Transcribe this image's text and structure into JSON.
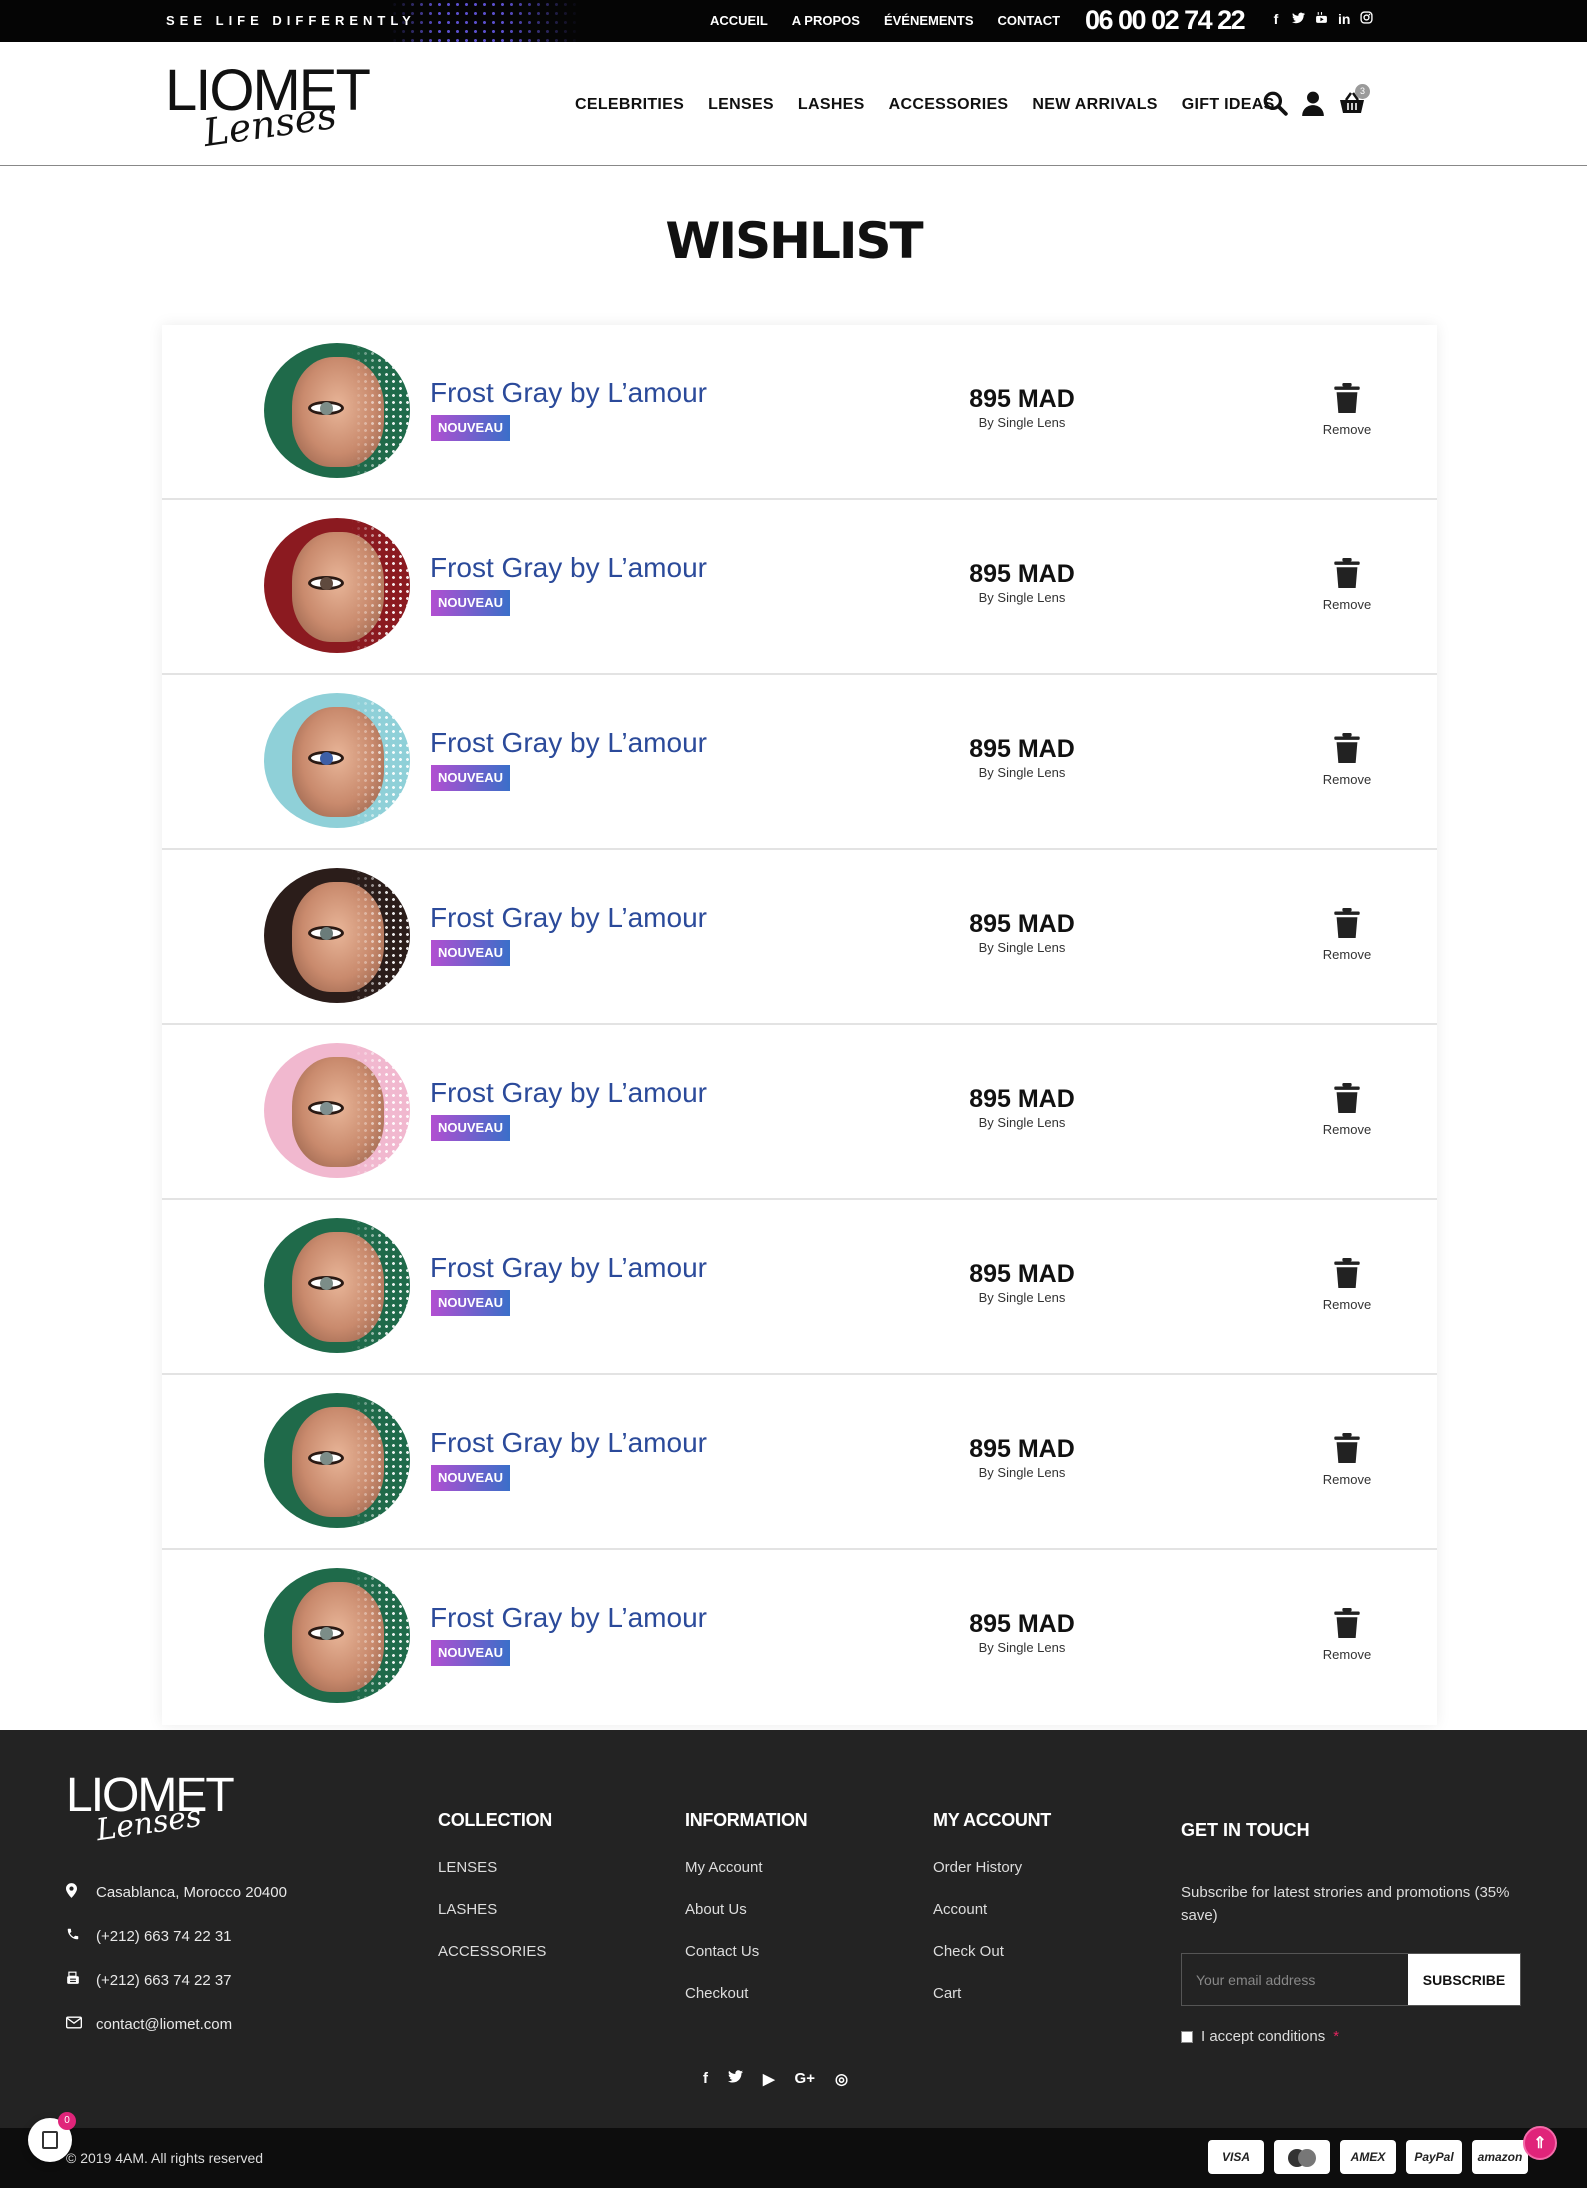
{
  "topbar": {
    "tagline": "SEE LIFE DIFFERENTLY",
    "nav": [
      "ACCUEIL",
      "A PROPOS",
      "ÉVÉNEMENTS",
      "CONTACT"
    ],
    "phone": "06 00 02 74 22",
    "socials": [
      "f",
      "t",
      "yt",
      "in",
      "ig"
    ]
  },
  "header": {
    "logo_main": "LIOMET",
    "logo_script": "Lenses",
    "nav": [
      "CELEBRITIES",
      "LENSES",
      "LASHES",
      "ACCESSORIES",
      "NEW ARRIVALS",
      "GIFT IDEAS"
    ],
    "cart_count": "3",
    "icons": [
      "search-icon",
      "user-icon",
      "basket-icon"
    ]
  },
  "page_title": "WISHLIST",
  "wishlist": {
    "items": [
      {
        "name": "Frost Gray by L’amour",
        "tag": "NOUVEAU",
        "price": "895 MAD",
        "price_sub": "By Single Lens",
        "remove": "Remove",
        "bg": "#1f6a4a",
        "iris": "#7c8d88"
      },
      {
        "name": "Frost Gray by L’amour",
        "tag": "NOUVEAU",
        "price": "895 MAD",
        "price_sub": "By Single Lens",
        "remove": "Remove",
        "bg": "#8b1a20",
        "iris": "#5f4a3e"
      },
      {
        "name": "Frost Gray by L’amour",
        "tag": "NOUVEAU",
        "price": "895 MAD",
        "price_sub": "By Single Lens",
        "remove": "Remove",
        "bg": "#8fd0d8",
        "iris": "#3d5fa6"
      },
      {
        "name": "Frost Gray by L’amour",
        "tag": "NOUVEAU",
        "price": "895 MAD",
        "price_sub": "By Single Lens",
        "remove": "Remove",
        "bg": "#2b1d1a",
        "iris": "#6b7c7a"
      },
      {
        "name": "Frost Gray by L’amour",
        "tag": "NOUVEAU",
        "price": "895 MAD",
        "price_sub": "By Single Lens",
        "remove": "Remove",
        "bg": "#f1b8cf",
        "iris": "#7f8f8f"
      },
      {
        "name": "Frost Gray by L’amour",
        "tag": "NOUVEAU",
        "price": "895 MAD",
        "price_sub": "By Single Lens",
        "remove": "Remove",
        "bg": "#1f6a4a",
        "iris": "#7c8d88"
      },
      {
        "name": "Frost Gray by L’amour",
        "tag": "NOUVEAU",
        "price": "895 MAD",
        "price_sub": "By Single Lens",
        "remove": "Remove",
        "bg": "#1f6a4a",
        "iris": "#7c8d88"
      },
      {
        "name": "Frost Gray by L’amour",
        "tag": "NOUVEAU",
        "price": "895 MAD",
        "price_sub": "By Single Lens",
        "remove": "Remove",
        "bg": "#1f6a4a",
        "iris": "#7c8d88"
      }
    ]
  },
  "footer": {
    "logo_main": "LIOMET",
    "logo_script": "Lenses",
    "contact": [
      {
        "icon": "location-icon",
        "text": "Casablanca, Morocco 20400"
      },
      {
        "icon": "phone-icon",
        "text": "(+212) 663 74 22 31"
      },
      {
        "icon": "fax-icon",
        "text": "(+212) 663 74 22 37"
      },
      {
        "icon": "mail-icon",
        "text": "contact@liomet.com"
      }
    ],
    "columns": [
      {
        "title": "COLLECTION",
        "links": [
          "LENSES",
          "LASHES",
          "ACCESSORIES"
        ]
      },
      {
        "title": "INFORMATION",
        "links": [
          "My Account",
          "About Us",
          "Contact Us",
          "Checkout"
        ]
      },
      {
        "title": "MY ACCOUNT",
        "links": [
          "Order History",
          "Account",
          "Check Out",
          "Cart"
        ]
      }
    ],
    "get_in_touch": {
      "title": "GET IN TOUCH",
      "text": "Subscribe for latest strories and promotions (35% save)",
      "placeholder": "Your email address",
      "button": "SUBSCRIBE",
      "accept": "I accept conditions",
      "required": "*"
    },
    "socials": [
      "f",
      "t",
      "▶",
      "G+",
      "◎"
    ],
    "copyright": "© 2019 4AM. All rights reserved",
    "mini_cart_count": "0",
    "payments": [
      "VISA",
      "MC",
      "AMEX",
      "PayPal",
      "amazon"
    ],
    "to_top": "⇑"
  }
}
